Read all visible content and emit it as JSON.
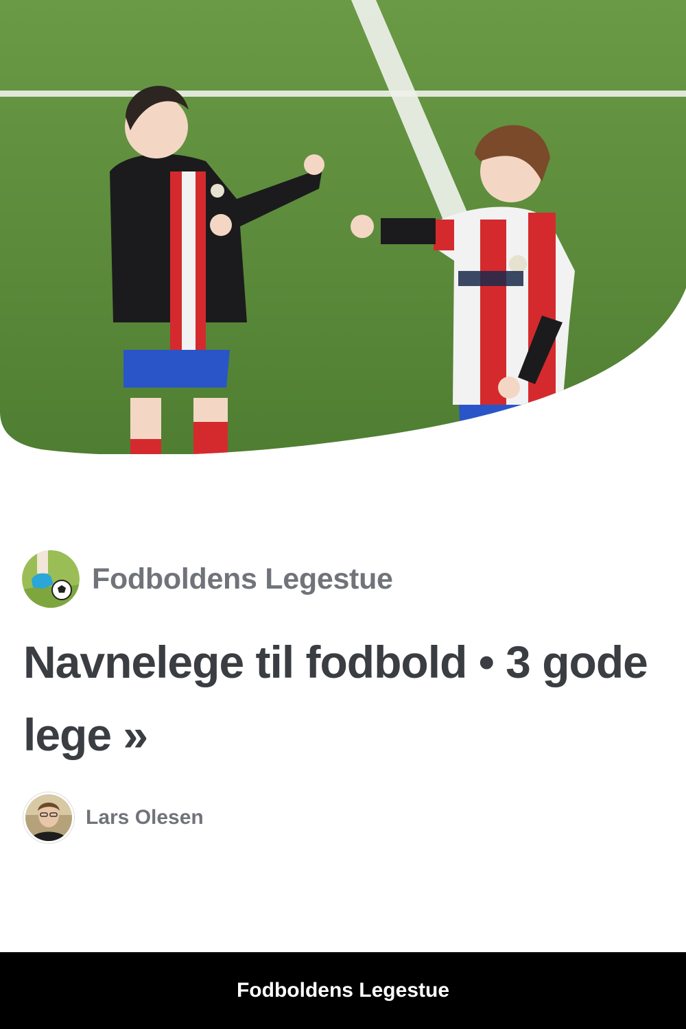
{
  "publisher": {
    "name": "Fodboldens Legestue",
    "logo_icon": "football-kick-logo-icon"
  },
  "story": {
    "title": "Navnelege til fodbold • 3 gode lege »"
  },
  "author": {
    "name": "Lars Olesen",
    "avatar_icon": "author-avatar-photo"
  },
  "footer": {
    "label": "Fodboldens Legestue"
  },
  "colors": {
    "pitch_green": "#5f8f3c",
    "jersey_red": "#d42a2e",
    "title_text": "#3a3d42",
    "muted_text": "#70737a",
    "footer_bg": "#000000"
  }
}
